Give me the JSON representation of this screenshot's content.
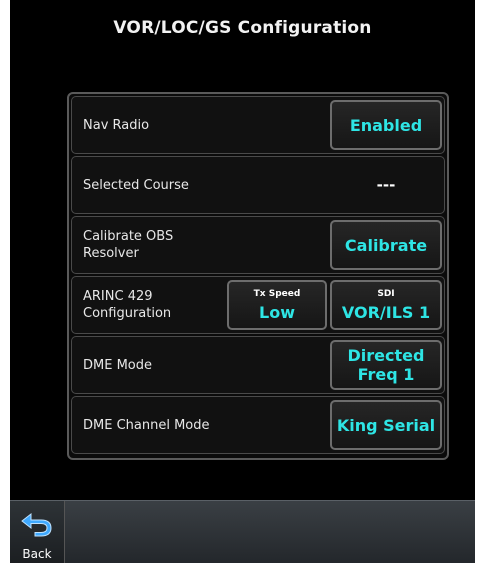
{
  "title": "VOR/LOC/GS Configuration",
  "rows": {
    "nav_radio": {
      "label": "Nav Radio",
      "button": "Enabled"
    },
    "selected_course": {
      "label": "Selected Course",
      "value": "---"
    },
    "calibrate_obs": {
      "label": "Calibrate OBS\nResolver",
      "button": "Calibrate"
    },
    "arinc_429": {
      "label": "ARINC 429\nConfiguration",
      "tx_speed": {
        "caption": "Tx Speed",
        "value": "Low"
      },
      "sdi": {
        "caption": "SDI",
        "value": "VOR/ILS 1"
      }
    },
    "dme_mode": {
      "label": "DME Mode",
      "button_line1": "Directed",
      "button_line2": "Freq 1"
    },
    "dme_channel_mode": {
      "label": "DME Channel Mode",
      "button": "King Serial"
    }
  },
  "bottom_bar": {
    "back_label": "Back",
    "back_icon": "back-arrow-icon"
  },
  "colors": {
    "accent": "#2ee5e5",
    "background": "#000000",
    "bar": "#2f3438"
  }
}
